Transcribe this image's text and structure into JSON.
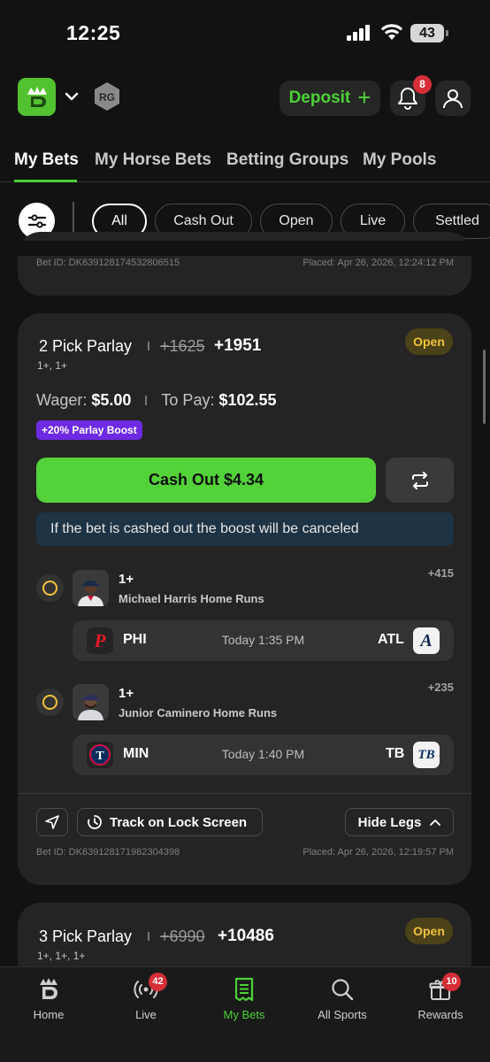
{
  "status_bar": {
    "time": "12:25",
    "battery": "43"
  },
  "header": {
    "deposit_label": "Deposit",
    "notification_count": "8"
  },
  "tabs": [
    {
      "label": "My Bets"
    },
    {
      "label": "My Horse Bets"
    },
    {
      "label": "Betting Groups"
    },
    {
      "label": "My Pools"
    }
  ],
  "filters": [
    {
      "label": "All"
    },
    {
      "label": "Cash Out"
    },
    {
      "label": "Open"
    },
    {
      "label": "Live"
    },
    {
      "label": "Settled"
    }
  ],
  "previous_bet": {
    "bet_id": "Bet ID: DK639128174532806515",
    "placed": "Placed: Apr 26, 2026, 12:24:12 PM"
  },
  "bet": {
    "title": "2 Pick Parlay",
    "old_odds": "+1625",
    "new_odds": "+1951",
    "subtitle": "1+, 1+",
    "status": "Open",
    "wager_label": "Wager:",
    "wager": "$5.00",
    "to_pay_label": "To Pay:",
    "to_pay": "$102.55",
    "boost": "+20% Parlay Boost",
    "cash_out_label": "Cash Out $4.34",
    "boost_warning": "If the bet is cashed out the boost will be canceled",
    "legs": [
      {
        "line": "1+",
        "desc": "Michael Harris Home Runs",
        "odds": "+415",
        "home_team": "PHI",
        "away_team": "ATL",
        "time": "Today 1:35 PM"
      },
      {
        "line": "1+",
        "desc": "Junior Caminero Home Runs",
        "odds": "+235",
        "home_team": "MIN",
        "away_team": "TB",
        "time": "Today 1:40 PM"
      }
    ],
    "track_label": "Track on Lock Screen",
    "hide_legs_label": "Hide Legs",
    "bet_id": "Bet ID: DK639128171982304398",
    "placed": "Placed: Apr 26, 2026, 12:19:57 PM"
  },
  "next_bet": {
    "title": "3 Pick Parlay",
    "old_odds": "+6990",
    "new_odds": "+10486",
    "subtitle": "1+, 1+, 1+",
    "status": "Open"
  },
  "bottom_nav": [
    {
      "label": "Home",
      "icon": "home-crown-icon"
    },
    {
      "label": "Live",
      "icon": "live-broadcast-icon",
      "badge": "42"
    },
    {
      "label": "My Bets",
      "icon": "receipt-icon"
    },
    {
      "label": "All Sports",
      "icon": "search-icon"
    },
    {
      "label": "Rewards",
      "icon": "gift-icon",
      "badge": "10"
    }
  ],
  "colors": {
    "accent_green": "#4cd137",
    "open_badge_text": "#f2c23a",
    "boost_purple": "#6e2ae2",
    "badge_red": "#d62e37"
  }
}
